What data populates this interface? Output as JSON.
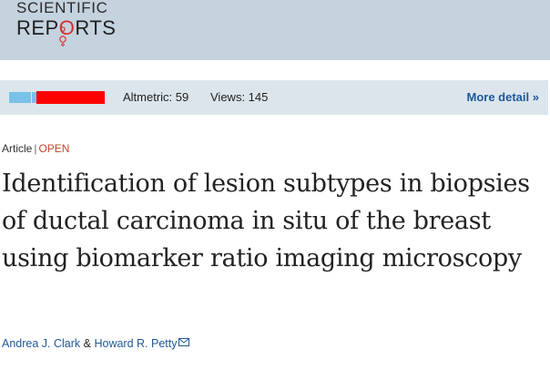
{
  "header": {
    "logo_top": "SCIENTIFIC",
    "logo_bottom_left": "REP",
    "logo_bottom_o": "O",
    "logo_bottom_right": "RTS",
    "logo_accent_color": "#d3312d",
    "background_color": "#c5d3df"
  },
  "metrics": {
    "altmetric": "Altmetric: 59",
    "views": "Views: 145",
    "more_detail": "More detail",
    "more_detail_icon": "double-chevron-right-icon",
    "bar_colors": {
      "blue": "#79c1e8",
      "red": "#ff0000"
    }
  },
  "article": {
    "type": "Article",
    "separator": "|",
    "access": "OPEN",
    "title": "Identification of lesion subtypes in biopsies of ductal carcinoma in situ of the breast using biomarker ratio imaging microscopy",
    "authors": [
      "Andrea J. Clark",
      "Howard R. Petty"
    ],
    "author_joiner": "&",
    "mail_icon": "envelope-icon"
  },
  "colors": {
    "link": "#1f5899",
    "open_label": "#c1452d"
  }
}
